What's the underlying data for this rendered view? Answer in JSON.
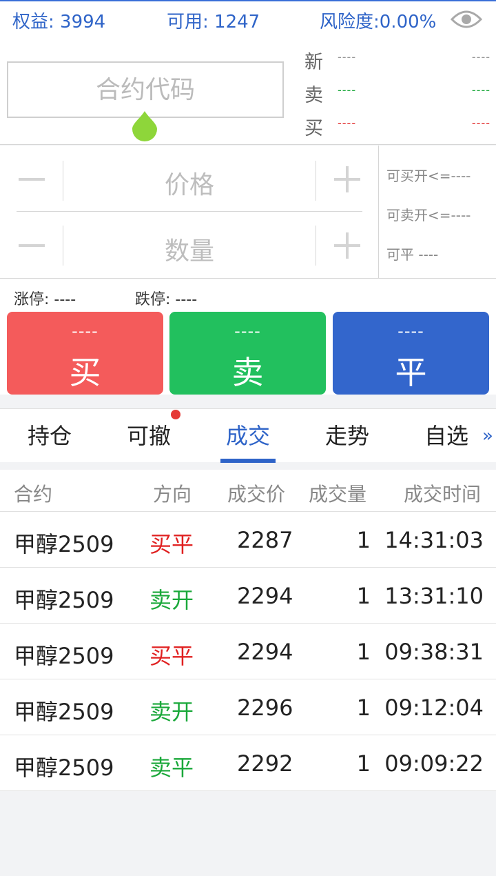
{
  "status": {
    "equity": "权益: 3994",
    "available": "可用: 1247",
    "risk": "风险度:0.00%",
    "eye_icon": "eye-icon"
  },
  "contract": {
    "placeholder": "合约代码",
    "quotes": [
      {
        "label": "新",
        "left": "----",
        "right": "----",
        "color": "#999999"
      },
      {
        "label": "卖",
        "left": "----",
        "right": "----",
        "color": "#1aa83a"
      },
      {
        "label": "买",
        "left": "----",
        "right": "----",
        "color": "#e02020"
      }
    ]
  },
  "order": {
    "price_placeholder": "价格",
    "qty_placeholder": "数量",
    "can_buy_open": "可买开<=----",
    "can_sell_open": "可卖开<=----",
    "can_close": "可平  ----"
  },
  "limits": {
    "limit_up": "涨停: ----",
    "limit_down": "跌停: ----"
  },
  "actions": {
    "buy": {
      "price": "----",
      "label": "买",
      "color": "#f45b5b"
    },
    "sell": {
      "price": "----",
      "label": "卖",
      "color": "#22c05e"
    },
    "close": {
      "price": "----",
      "label": "平",
      "color": "#3366cc"
    }
  },
  "tabs": [
    "持仓",
    "可撤",
    "成交",
    "走势",
    "自选"
  ],
  "active_tab": "成交",
  "more_icon": "double-chevron-right-icon",
  "table": {
    "headers": [
      "合约",
      "方向",
      "成交价",
      "成交量",
      "成交时间"
    ],
    "rows": [
      {
        "contract": "甲醇2509",
        "direction": "买平",
        "price": "2287",
        "qty": "1",
        "time": "14:31:03"
      },
      {
        "contract": "甲醇2509",
        "direction": "卖开",
        "price": "2294",
        "qty": "1",
        "time": "13:31:10"
      },
      {
        "contract": "甲醇2509",
        "direction": "买平",
        "price": "2294",
        "qty": "1",
        "time": "09:38:31"
      },
      {
        "contract": "甲醇2509",
        "direction": "卖开",
        "price": "2296",
        "qty": "1",
        "time": "09:12:04"
      },
      {
        "contract": "甲醇2509",
        "direction": "卖平",
        "price": "2292",
        "qty": "1",
        "time": "09:09:22"
      }
    ]
  },
  "colors": {
    "accent": "#2f64c8",
    "buy_direction": "#e02020",
    "sell_direction": "#1aa83a"
  }
}
